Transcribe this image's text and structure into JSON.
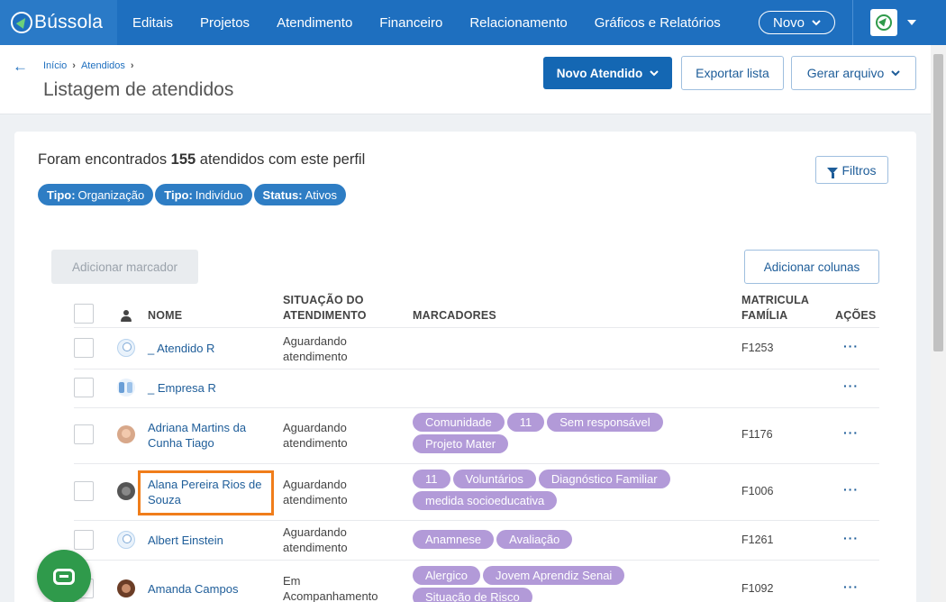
{
  "app": {
    "name": "Bússola"
  },
  "nav": {
    "items": [
      "Editais",
      "Projetos",
      "Atendimento",
      "Financeiro",
      "Relacionamento",
      "Gráficos e Relatórios"
    ],
    "novo_label": "Novo"
  },
  "header": {
    "breadcrumb": [
      "Início",
      "Atendidos"
    ],
    "title": "Listagem de atendidos",
    "btn_novo_atendido": "Novo Atendido",
    "btn_exportar": "Exportar lista",
    "btn_gerar": "Gerar arquivo"
  },
  "summary": {
    "prefix": "Foram encontrados",
    "count": "155",
    "suffix": "atendidos com este perfil"
  },
  "filters_button": "Filtros",
  "chips": [
    {
      "key": "Tipo:",
      "value": "Organização"
    },
    {
      "key": "Tipo:",
      "value": "Indivíduo"
    },
    {
      "key": "Status:",
      "value": "Ativos"
    }
  ],
  "actions": {
    "add_marker": "Adicionar marcador",
    "add_columns": "Adicionar colunas"
  },
  "table": {
    "headers": {
      "nome": "NOME",
      "situacao": "SITUAÇÃO DO ATENDIMENTO",
      "marcadores": "MARCADORES",
      "matricula": "MATRICULA FAMÍLIA",
      "acoes": "AÇÕES"
    },
    "rows": [
      {
        "name": "_ Atendido R",
        "situacao": "Aguardando atendimento",
        "tags": [],
        "matricula": "F1253",
        "acoes": "···"
      },
      {
        "name": "_ Empresa R",
        "situacao": "",
        "tags": [],
        "matricula": "",
        "acoes": "···"
      },
      {
        "name": "Adriana Martins da Cunha Tiago",
        "situacao": "Aguardando atendimento",
        "tags": [
          "Comunidade",
          "11",
          "Sem responsável",
          "Projeto Mater"
        ],
        "matricula": "F1176",
        "acoes": "···"
      },
      {
        "name": "Alana Pereira Rios de Souza",
        "situacao": "Aguardando atendimento",
        "tags": [
          "11",
          "Voluntários",
          "Diagnóstico Familiar",
          "medida socioeducativa"
        ],
        "matricula": "F1006",
        "acoes": "···"
      },
      {
        "name": "Albert Einstein",
        "situacao": "Aguardando atendimento",
        "tags": [
          "Anamnese",
          "Avaliação"
        ],
        "matricula": "F1261",
        "acoes": "···"
      },
      {
        "name": "Amanda Campos",
        "situacao": "Em Acompanhamento",
        "tags": [
          "Alergico",
          "Jovem Aprendiz Senai",
          "Situação de Risco"
        ],
        "matricula": "F1092",
        "acoes": "···"
      }
    ]
  },
  "colors": {
    "nav": "#1e6fbf",
    "primary": "#1467b3",
    "tag": "#b29ad8",
    "chip": "#2e7dc4",
    "highlight": "#f07d1a",
    "chat": "#2f9a4b"
  }
}
